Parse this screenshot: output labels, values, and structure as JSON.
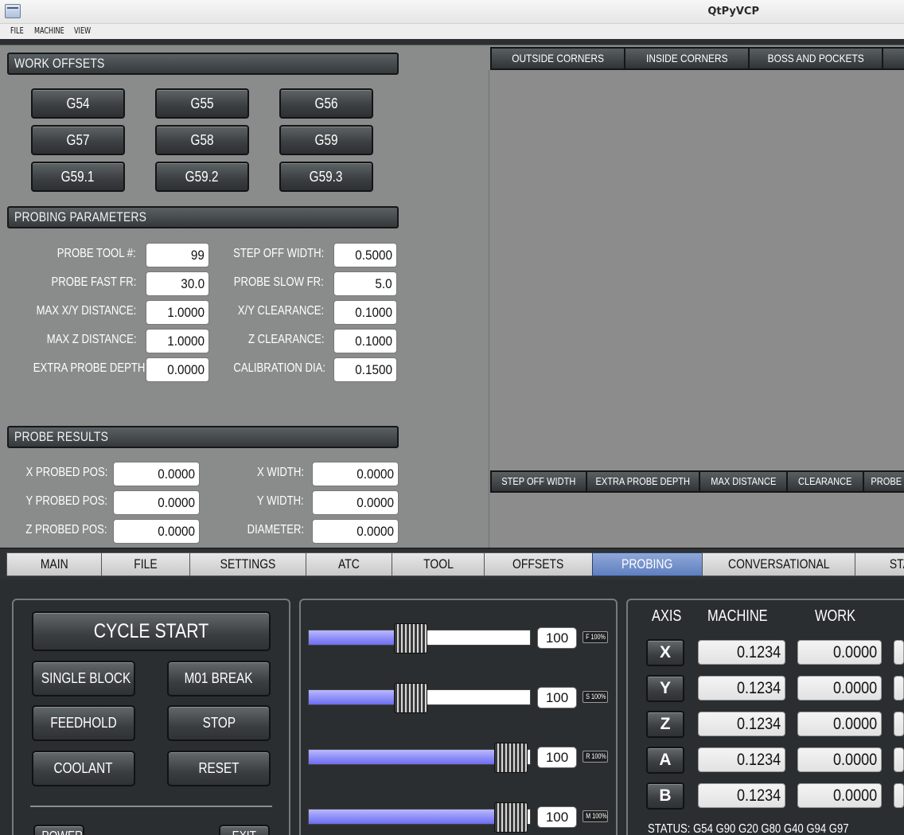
{
  "window": {
    "title": "QtPyVCP"
  },
  "menu": [
    "FILE",
    "MACHINE",
    "VIEW"
  ],
  "work_offsets": {
    "title": "WORK OFFSETS",
    "buttons": [
      "G54",
      "G55",
      "G56",
      "G57",
      "G58",
      "G59",
      "G59.1",
      "G59.2",
      "G59.3"
    ]
  },
  "probing_parameters": {
    "title": "PROBING PARAMETERS",
    "left": [
      {
        "label": "PROBE TOOL #:",
        "value": "99"
      },
      {
        "label": "PROBE FAST FR:",
        "value": "30.0"
      },
      {
        "label": "MAX X/Y DISTANCE:",
        "value": "1.0000"
      },
      {
        "label": "MAX Z DISTANCE:",
        "value": "1.0000"
      },
      {
        "label": "EXTRA PROBE DEPTH:",
        "value": "0.0000"
      }
    ],
    "right": [
      {
        "label": "STEP OFF WIDTH:",
        "value": "0.5000"
      },
      {
        "label": "PROBE SLOW FR:",
        "value": "5.0"
      },
      {
        "label": "X/Y CLEARANCE:",
        "value": "0.1000"
      },
      {
        "label": "Z CLEARANCE:",
        "value": "0.1000"
      },
      {
        "label": "CALIBRATION DIA:",
        "value": "0.1500"
      }
    ]
  },
  "probe_results": {
    "title": "PROBE RESULTS",
    "left": [
      {
        "label": "X PROBED POS:",
        "value": "0.0000"
      },
      {
        "label": "Y PROBED POS:",
        "value": "0.0000"
      },
      {
        "label": "Z PROBED POS:",
        "value": "0.0000"
      }
    ],
    "right": [
      {
        "label": "X WIDTH:",
        "value": "0.0000"
      },
      {
        "label": "Y WIDTH:",
        "value": "0.0000"
      },
      {
        "label": "DIAMETER:",
        "value": "0.0000"
      }
    ]
  },
  "probe_type_tabs": [
    "OUTSIDE CORNERS",
    "INSIDE CORNERS",
    "BOSS AND POCKETS",
    ""
  ],
  "help_tabs": [
    "STEP OFF WIDTH",
    "EXTRA PROBE DEPTH",
    "MAX DISTANCE",
    "CLEARANCE",
    "PROBE"
  ],
  "main_tabs": [
    "MAIN",
    "FILE",
    "SETTINGS",
    "ATC",
    "TOOL",
    "OFFSETS",
    "PROBING",
    "CONVERSATIONAL",
    "STA"
  ],
  "active_tab": "PROBING",
  "controls": {
    "cycle_start": "CYCLE START",
    "single_block": "SINGLE BLOCK",
    "m01_break": "M01 BREAK",
    "feedhold": "FEEDHOLD",
    "stop": "STOP",
    "coolant": "COOLANT",
    "reset": "RESET",
    "power": "POWER",
    "exit": "EXIT"
  },
  "overrides": [
    {
      "value": "100",
      "badge": "F 100%",
      "level": 0.45
    },
    {
      "value": "100",
      "badge": "S 100%",
      "level": 0.45
    },
    {
      "value": "100",
      "badge": "R 100%",
      "level": 0.9
    },
    {
      "value": "100",
      "badge": "M 100%",
      "level": 0.9
    }
  ],
  "dro": {
    "headers": {
      "axis": "AXIS",
      "machine": "MACHINE",
      "work": "WORK"
    },
    "rows": [
      {
        "axis": "X",
        "machine": "0.1234",
        "work": "0.0000"
      },
      {
        "axis": "Y",
        "machine": "0.1234",
        "work": "0.0000"
      },
      {
        "axis": "Z",
        "machine": "0.1234",
        "work": "0.0000"
      },
      {
        "axis": "A",
        "machine": "0.1234",
        "work": "0.0000"
      },
      {
        "axis": "B",
        "machine": "0.1234",
        "work": "0.0000"
      }
    ],
    "status": "STATUS:  G54  G90  G20  G80  G40  G94  G97"
  }
}
